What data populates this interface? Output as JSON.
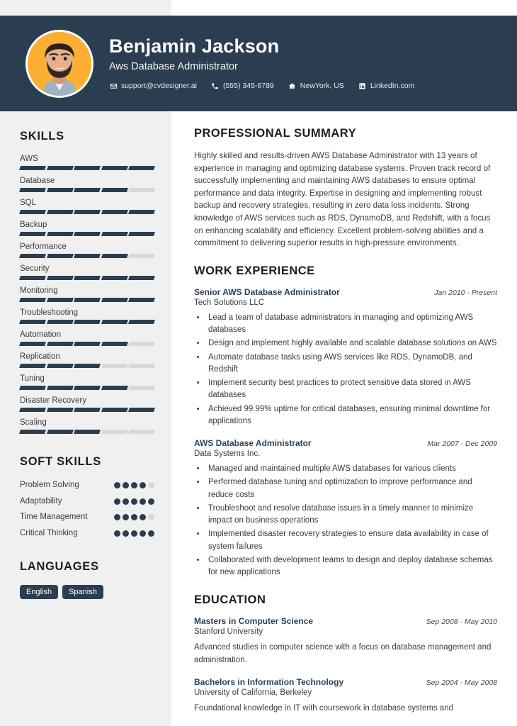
{
  "header": {
    "name": "Benjamin Jackson",
    "job_title": "Aws Database Administrator",
    "avatar_bg": "#fbb034",
    "band_color": "#2b3e51",
    "contacts": [
      {
        "icon": "envelope-icon",
        "text": "support@cvdesigner.ai"
      },
      {
        "icon": "phone-icon",
        "text": "(555) 345-6789"
      },
      {
        "icon": "home-icon",
        "text": "NewYork, US"
      },
      {
        "icon": "linkedin-icon",
        "text": "LinkedIn.com"
      }
    ]
  },
  "sidebar": {
    "skills_heading": "SKILLS",
    "skills_max": 5,
    "skills": [
      {
        "label": "AWS",
        "level": 5
      },
      {
        "label": "Database",
        "level": 4
      },
      {
        "label": "SQL",
        "level": 5
      },
      {
        "label": "Backup",
        "level": 5
      },
      {
        "label": "Performance",
        "level": 4
      },
      {
        "label": "Security",
        "level": 5
      },
      {
        "label": "Monitoring",
        "level": 5
      },
      {
        "label": "Troubleshooting",
        "level": 5
      },
      {
        "label": "Automation",
        "level": 4
      },
      {
        "label": "Replication",
        "level": 3
      },
      {
        "label": "Tuning",
        "level": 4
      },
      {
        "label": "Disaster Recovery",
        "level": 5
      },
      {
        "label": "Scaling",
        "level": 3
      }
    ],
    "soft_skills_heading": "SOFT SKILLS",
    "soft_skills_max": 5,
    "soft_skills": [
      {
        "label": "Problem Solving",
        "level": 4
      },
      {
        "label": "Adaptability",
        "level": 5
      },
      {
        "label": "Time Management",
        "level": 4
      },
      {
        "label": "Critical Thinking",
        "level": 5
      }
    ],
    "languages_heading": "LANGUAGES",
    "languages": [
      "English",
      "Spanish"
    ]
  },
  "main": {
    "summary_heading": "PROFESSIONAL SUMMARY",
    "summary_text": "Highly skilled and results-driven AWS Database Administrator with 13 years of experience in managing and optimizing database systems. Proven track record of successfully implementing and maintaining AWS databases to ensure optimal performance and data integrity. Expertise in designing and implementing robust backup and recovery strategies, resulting in zero data loss incidents. Strong knowledge of AWS services such as RDS, DynamoDB, and Redshift, with a focus on enhancing scalability and efficiency. Excellent problem-solving abilities and a commitment to delivering superior results in high-pressure environments.",
    "experience_heading": "WORK EXPERIENCE",
    "experience": [
      {
        "title": "Senior AWS Database Administrator",
        "date": "Jan 2010 - Present",
        "org": "Tech Solutions LLC",
        "bullets": [
          "Lead a team of database administrators in managing and optimizing AWS databases",
          "Design and implement highly available and scalable database solutions on AWS",
          "Automate database tasks using AWS services like RDS, DynamoDB, and Redshift",
          "Implement security best practices to protect sensitive data stored in AWS databases",
          "Achieved 99.99% uptime for critical databases, ensuring minimal downtime for applications"
        ]
      },
      {
        "title": "AWS Database Administrator",
        "date": "Mar 2007 - Dec 2009",
        "org": "Data Systems Inc.",
        "bullets": [
          "Managed and maintained multiple AWS databases for various clients",
          "Performed database tuning and optimization to improve performance and reduce costs",
          "Troubleshoot and resolve database issues in a timely manner to minimize impact on business operations",
          "Implemented disaster recovery strategies to ensure data availability in case of system failures",
          "Collaborated with development teams to design and deploy database schemas for new applications"
        ]
      }
    ],
    "education_heading": "EDUCATION",
    "education": [
      {
        "title": "Masters in Computer Science",
        "date": "Sep 2008 - May 2010",
        "org": "Stanford University",
        "desc": "Advanced studies in computer science with a focus on database management and administration."
      },
      {
        "title": "Bachelors in Information Technology",
        "date": "Sep 2004 - May 2008",
        "org": "University of California, Berkeley",
        "desc": "Foundational knowledge in IT with coursework in database systems and"
      }
    ]
  }
}
